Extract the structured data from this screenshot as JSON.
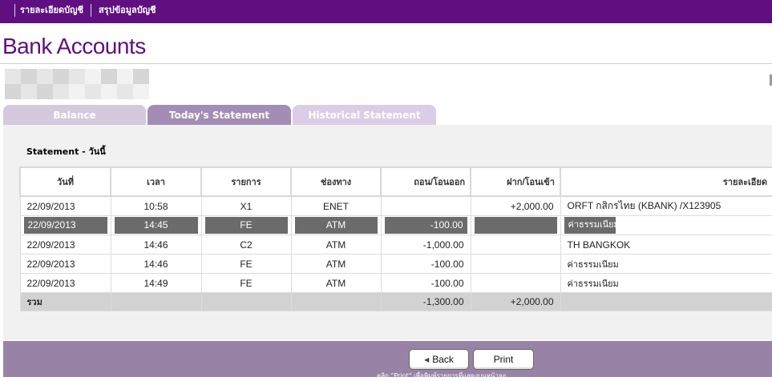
{
  "topnav": {
    "items": [
      "รายละเอียดบัญชี",
      "สรุปข้อมูลบัญชี"
    ]
  },
  "page": {
    "title": "Bank Accounts"
  },
  "tabs": [
    {
      "label": "Balance",
      "active": false
    },
    {
      "label": "Today's Statement",
      "active": true
    },
    {
      "label": "Historical Statement",
      "active": false
    }
  ],
  "statement": {
    "title": "Statement - วันนี้",
    "columns": [
      "วันที่",
      "เวลา",
      "รายการ",
      "ช่องทาง",
      "ถอน/โอนออก",
      "ฝาก/โอนเข้า",
      "รายละเอียด"
    ],
    "rows": [
      {
        "date": "22/09/2013",
        "time": "10:58",
        "code": "X1",
        "channel": "ENET",
        "withdraw": "",
        "deposit": "+2,000.00",
        "detail": "ORFT กสิกรไทย (KBANK) /X123905"
      },
      {
        "date": "22/09/2013",
        "time": "14:45",
        "code": "FE",
        "channel": "ATM",
        "withdraw": "-100.00",
        "deposit": "",
        "detail": "ค่าธรรมเนียม"
      },
      {
        "date": "22/09/2013",
        "time": "14:46",
        "code": "C2",
        "channel": "ATM",
        "withdraw": "-1,000.00",
        "deposit": "",
        "detail": "TH BANGKOK"
      },
      {
        "date": "22/09/2013",
        "time": "14:46",
        "code": "FE",
        "channel": "ATM",
        "withdraw": "-100.00",
        "deposit": "",
        "detail": "ค่าธรรมเนียม"
      },
      {
        "date": "22/09/2013",
        "time": "14:49",
        "code": "FE",
        "channel": "ATM",
        "withdraw": "-100.00",
        "deposit": "",
        "detail": "ค่าธรรมเนียม"
      }
    ],
    "selected_row": 1,
    "total": {
      "label": "รวม",
      "withdraw": "-1,300.00",
      "deposit": "+2,000.00"
    }
  },
  "footer": {
    "back_label": "Back",
    "print_label": "Print",
    "note": "คลิก \"Print\" เพื่อพิมพ์รายการที่แสดงบนหน้าจอ"
  },
  "colors": {
    "brand": "#5f0f80",
    "tab_active": "#a38db4",
    "footer": "#9883a7",
    "selection": "#6b6b6b"
  }
}
